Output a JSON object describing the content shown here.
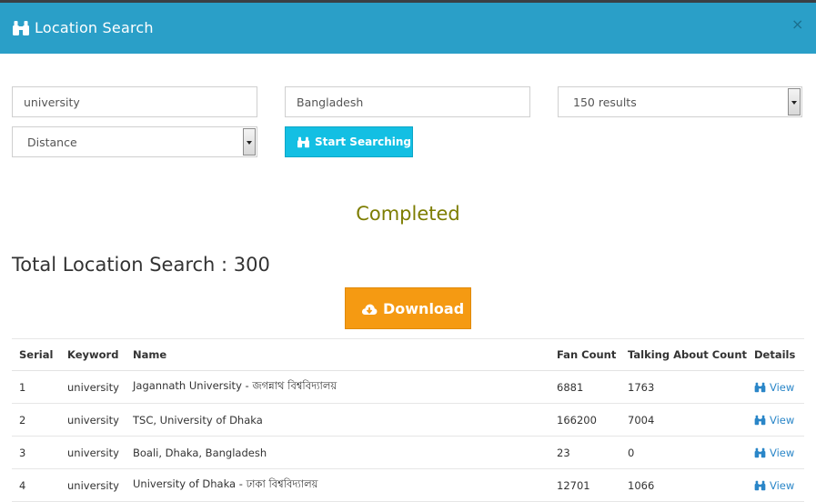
{
  "header": {
    "title": "Location Search",
    "close": "×",
    "icon": "binoculars-icon"
  },
  "form": {
    "keyword_value": "university",
    "country_value": "Bangladesh",
    "results_select": "150 results",
    "sort_select": "Distance",
    "search_button": "Start Searching"
  },
  "status": "Completed",
  "total_label": "Total Location Search : 300",
  "download_button": "Download",
  "colors": {
    "header": "#2a9fc8",
    "search_button": "#13bfe3",
    "download_button": "#f59a12",
    "status": "#7d7d00",
    "link": "#2a86c8"
  },
  "table": {
    "headers": [
      "Serial",
      "Keyword",
      "Name",
      "Fan Count",
      "Talking About Count",
      "Details"
    ],
    "rows": [
      {
        "serial": "1",
        "keyword": "university",
        "name": "Jagannath University - জগন্নাথ বিশ্ববিদ্যালয়",
        "fan_count": "6881",
        "talking": "1763",
        "details": "View"
      },
      {
        "serial": "2",
        "keyword": "university",
        "name": "TSC, University of Dhaka",
        "fan_count": "166200",
        "talking": "7004",
        "details": "View"
      },
      {
        "serial": "3",
        "keyword": "university",
        "name": "Boali, Dhaka, Bangladesh",
        "fan_count": "23",
        "talking": "0",
        "details": "View"
      },
      {
        "serial": "4",
        "keyword": "university",
        "name": "University of Dhaka - ঢাকা বিশ্ববিদ্যালয়",
        "fan_count": "12701",
        "talking": "1066",
        "details": "View"
      }
    ]
  }
}
